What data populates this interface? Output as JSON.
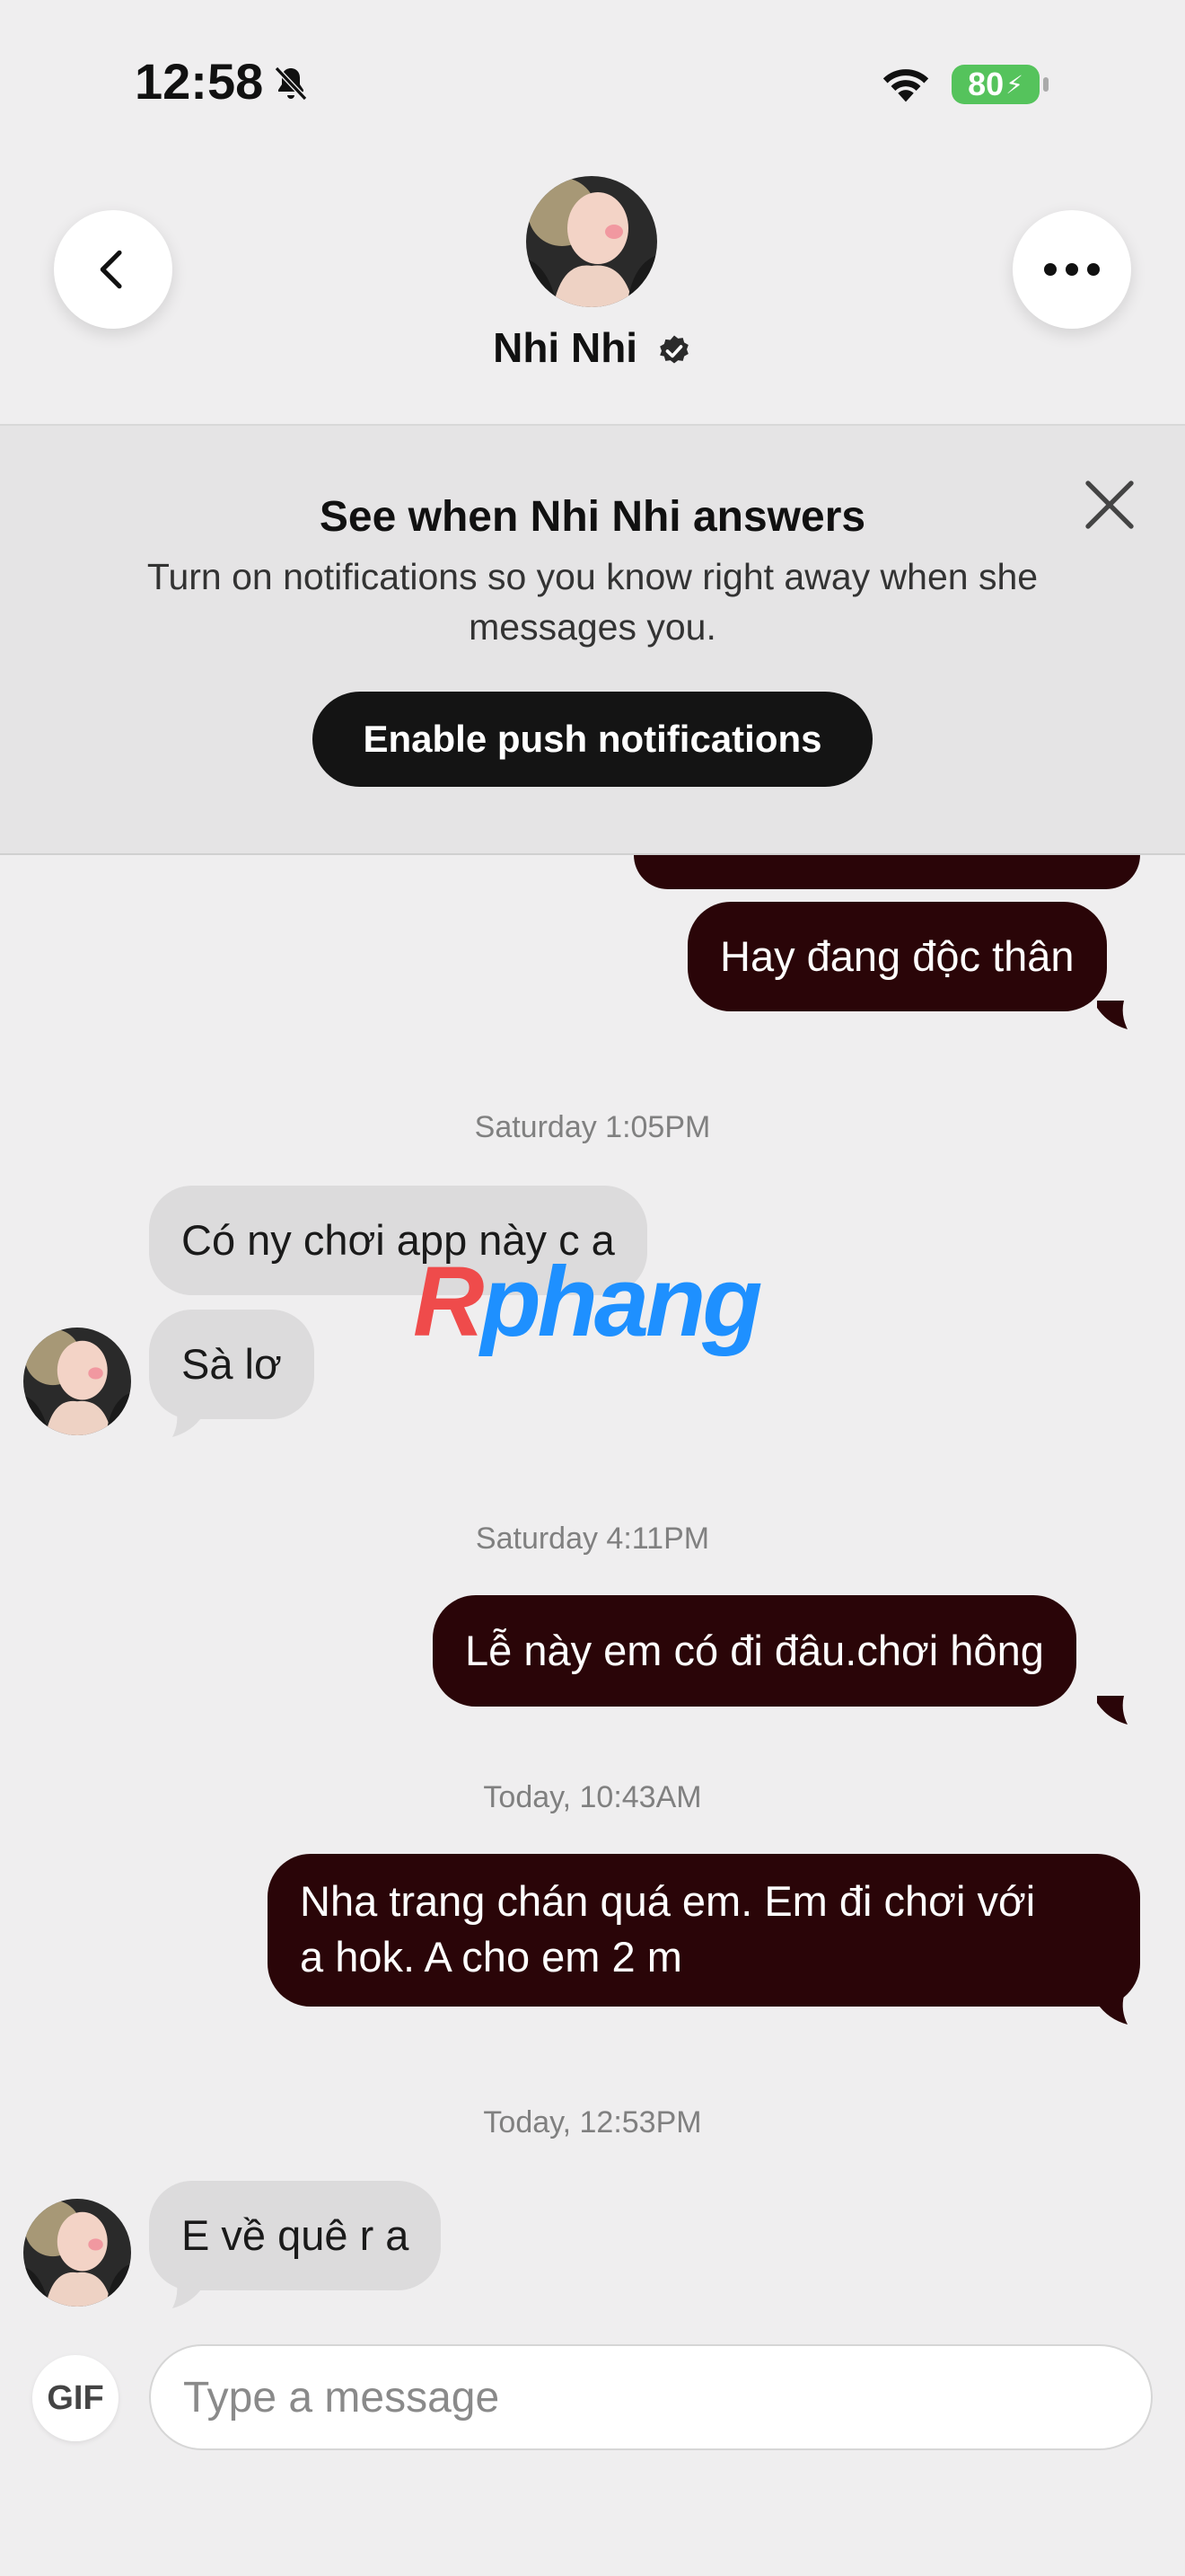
{
  "status_bar": {
    "time": "12:58",
    "battery": "80",
    "icons": [
      "bell-slash-icon",
      "wifi-icon",
      "battery-charging-icon"
    ]
  },
  "header": {
    "name": "Nhi Nhi",
    "icons": [
      "chevron-left-icon",
      "more-horizontal-icon",
      "verified-badge-icon"
    ]
  },
  "banner": {
    "title": "See when Nhi Nhi answers",
    "text": "Turn on notifications so you know right away when she messages you.",
    "button_label": "Enable push notifications"
  },
  "messages": {
    "m0": "Hay đang độc thân",
    "ts1": "Saturday 1:05PM",
    "m1": "Có ny chơi app này c a",
    "m2": "Sà lơ",
    "ts2": "Saturday 4:11PM",
    "m3": "Lễ này em có đi đâu.chơi hông",
    "ts3": "Today, 10:43AM",
    "m4_line1": "Nha trang chán quá em. Em đi chơi với",
    "m4_line2": "a hok. A cho em 2 m",
    "ts4": "Today, 12:53PM",
    "m5": "E về quê r a"
  },
  "watermark": {
    "part1": "R",
    "part2": "phang"
  },
  "composer": {
    "gif_label": "GIF",
    "placeholder": "Type a message"
  },
  "colors": {
    "background": "#efeeef",
    "outgoing_bubble": "#2a0508",
    "incoming_bubble": "#dcdbdc",
    "primary_button": "#141414",
    "battery": "#55c35c"
  }
}
